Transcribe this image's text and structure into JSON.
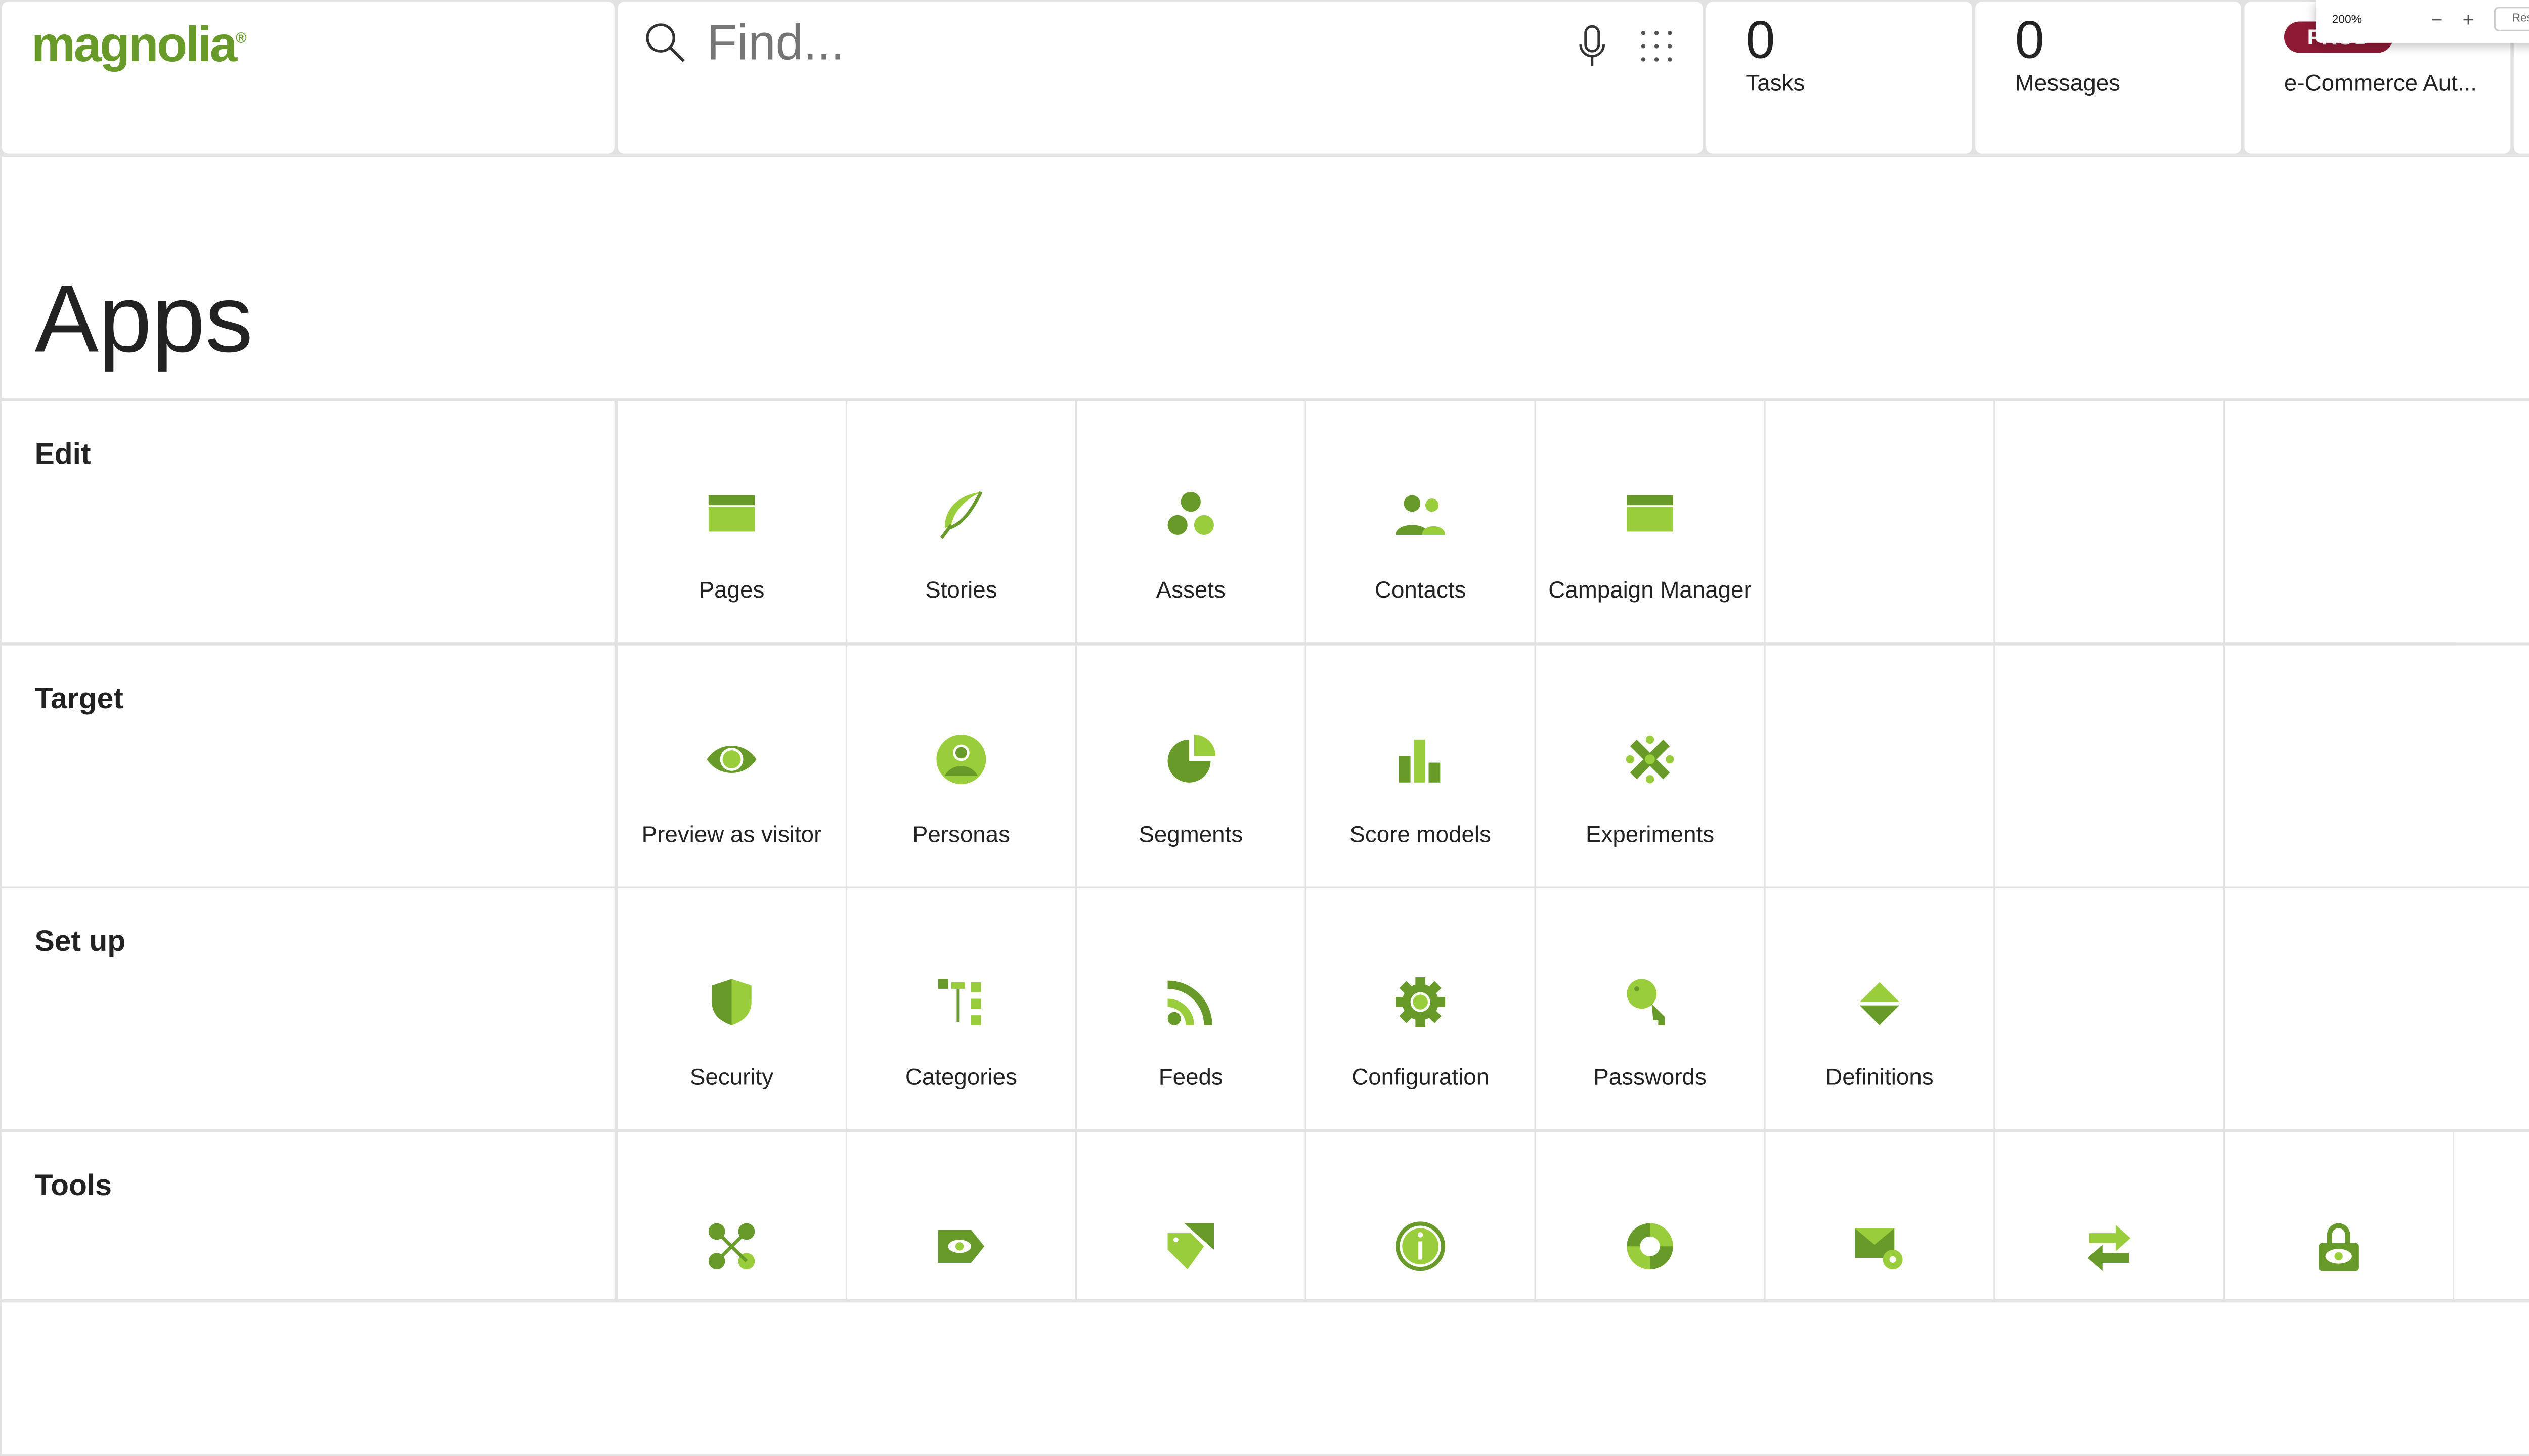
{
  "header": {
    "logo": "magnolia",
    "search": {
      "placeholder": "Find..."
    },
    "tasks": {
      "count": "0",
      "label": "Tasks"
    },
    "messages": {
      "count": "0",
      "label": "Messages"
    },
    "environment": {
      "badge": "PROD",
      "name": "e-Commerce Aut..."
    },
    "zoom_overlay": {
      "level": "200%",
      "minus": "−",
      "plus": "+",
      "reset": "Reset"
    }
  },
  "page_title": "Apps",
  "colors": {
    "dark_green": "#689a2a",
    "light_green": "#9acd3c",
    "prod_badge": "#8e1a35"
  },
  "groups": [
    {
      "label": "Edit",
      "apps": [
        {
          "label": "Pages",
          "icon": "pages-icon"
        },
        {
          "label": "Stories",
          "icon": "feather-icon"
        },
        {
          "label": "Assets",
          "icon": "assets-icon"
        },
        {
          "label": "Contacts",
          "icon": "contacts-icon"
        },
        {
          "label": "Campaign Manager",
          "icon": "campaign-icon"
        }
      ]
    },
    {
      "label": "Target",
      "apps": [
        {
          "label": "Preview as visitor",
          "icon": "eye-icon"
        },
        {
          "label": "Personas",
          "icon": "persona-icon"
        },
        {
          "label": "Segments",
          "icon": "pie-icon"
        },
        {
          "label": "Score models",
          "icon": "bar-chart-icon"
        },
        {
          "label": "Experiments",
          "icon": "experiments-icon"
        }
      ]
    },
    {
      "label": "Set up",
      "apps": [
        {
          "label": "Security",
          "icon": "shield-icon"
        },
        {
          "label": "Categories",
          "icon": "tree-icon"
        },
        {
          "label": "Feeds",
          "icon": "rss-icon"
        },
        {
          "label": "Configuration",
          "icon": "gear-icon"
        },
        {
          "label": "Passwords",
          "icon": "key-icon"
        },
        {
          "label": "Definitions",
          "icon": "definitions-icon"
        }
      ]
    },
    {
      "label": "Tools",
      "apps": [
        {
          "label": "",
          "icon": "network-icon"
        },
        {
          "label": "",
          "icon": "tag-eye-icon"
        },
        {
          "label": "",
          "icon": "tags-icon"
        },
        {
          "label": "",
          "icon": "info-icon"
        },
        {
          "label": "",
          "icon": "lifebuoy-icon"
        },
        {
          "label": "",
          "icon": "mail-gear-icon"
        },
        {
          "label": "",
          "icon": "arrows-exchange-icon"
        },
        {
          "label": "",
          "icon": "lock-eye-icon"
        }
      ]
    }
  ]
}
